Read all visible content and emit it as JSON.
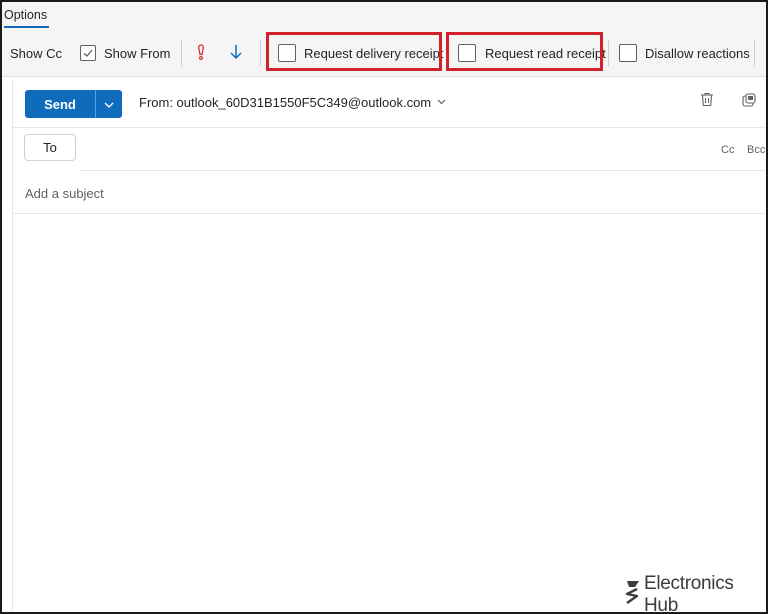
{
  "tabs": {
    "options_label": "Options"
  },
  "ribbon": {
    "show_cc": "Show Cc",
    "show_from": "Show From",
    "request_delivery_receipt": "Request delivery receipt",
    "request_read_receipt": "Request read receipt",
    "disallow_reactions": "Disallow reactions"
  },
  "compose": {
    "send_label": "Send",
    "from_text": "From: outlook_60D31B1550F5C349@outlook.com",
    "to_label": "To",
    "cc_label": "Cc",
    "bcc_label": "Bcc",
    "subject_placeholder": "Add a subject"
  },
  "watermark": {
    "text": "Electronics Hub"
  },
  "colors": {
    "accent": "#0f6cbd",
    "highlight": "#d0232c",
    "importance_high": "#d13438",
    "importance_low": "#0f6cbd"
  }
}
